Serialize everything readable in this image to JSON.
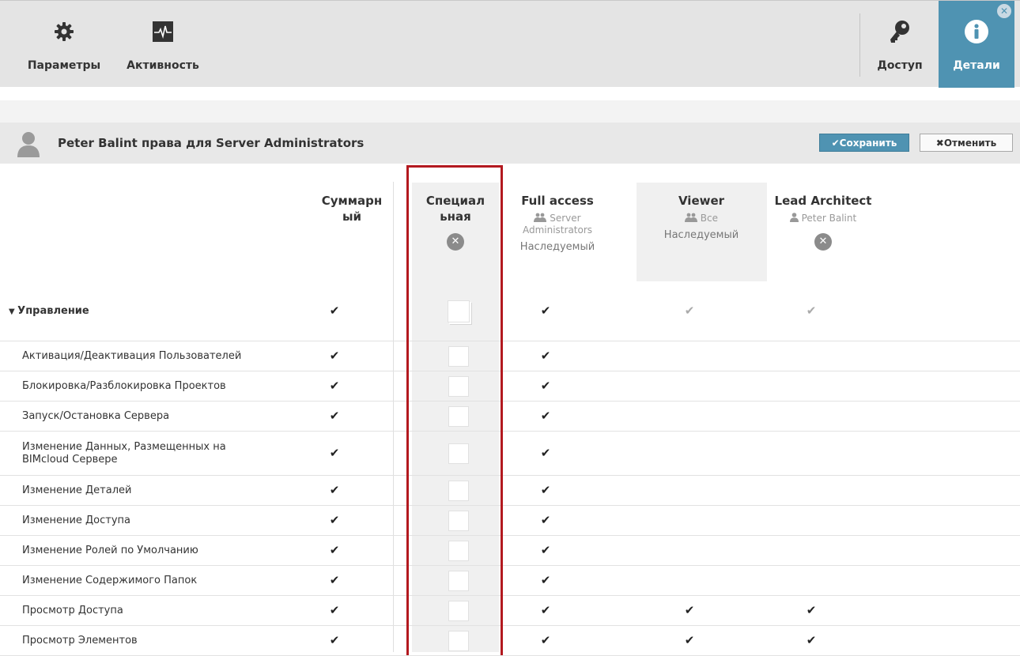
{
  "toolbar": {
    "left": [
      {
        "label": "Параметры",
        "icon": "gear-icon"
      },
      {
        "label": "Активность",
        "icon": "activity-icon"
      }
    ],
    "right": [
      {
        "label": "Доступ",
        "icon": "key-icon"
      },
      {
        "label": "Детали",
        "icon": "info-icon",
        "active": true
      }
    ],
    "close_glyph": "✕"
  },
  "panel": {
    "title": "Peter Balint права для Server Administrators",
    "save_label": "✔Сохранить",
    "cancel_label": "✖Отменить"
  },
  "columns": [
    {
      "title": "Суммарн\nый"
    },
    {
      "title": "Специал\nьная",
      "remove_glyph": "✕"
    },
    {
      "title": "Full access",
      "sub": "Server\nAdministrators",
      "sub_icon": "group-icon",
      "inherited": "Наследуемый"
    },
    {
      "title": "Viewer",
      "sub": "Все",
      "sub_icon": "group-icon",
      "inherited": "Наследуемый"
    },
    {
      "title": "Lead Architect",
      "sub": "Peter Balint",
      "sub_icon": "user-icon",
      "remove_glyph": "✕"
    }
  ],
  "check_glyph": "✔",
  "rows": [
    {
      "label": "Управление",
      "group": true,
      "summary": true,
      "full": true,
      "viewer": true,
      "lead": true
    },
    {
      "label": "Активация/Деактивация Пользователей",
      "summary": true,
      "full": true,
      "viewer": false,
      "lead": false
    },
    {
      "label": "Блокировка/Разблокировка Проектов",
      "summary": true,
      "full": true,
      "viewer": false,
      "lead": false
    },
    {
      "label": "Запуск/Остановка Сервера",
      "summary": true,
      "full": true,
      "viewer": false,
      "lead": false
    },
    {
      "label": "Изменение Данных, Размещенных на\nBIMcloud Сервере",
      "summary": true,
      "full": true,
      "viewer": false,
      "lead": false
    },
    {
      "label": "Изменение Деталей",
      "summary": true,
      "full": true,
      "viewer": false,
      "lead": false
    },
    {
      "label": "Изменение Доступа",
      "summary": true,
      "full": true,
      "viewer": false,
      "lead": false
    },
    {
      "label": "Изменение Ролей по Умолчанию",
      "summary": true,
      "full": true,
      "viewer": false,
      "lead": false
    },
    {
      "label": "Изменение Содержимого Папок",
      "summary": true,
      "full": true,
      "viewer": false,
      "lead": false
    },
    {
      "label": "Просмотр Доступа",
      "summary": true,
      "full": true,
      "viewer": true,
      "lead": true
    },
    {
      "label": "Просмотр Элементов",
      "summary": true,
      "full": true,
      "viewer": true,
      "lead": true
    }
  ],
  "colors": {
    "accent": "#4f93b2",
    "highlight": "#b3191f"
  }
}
